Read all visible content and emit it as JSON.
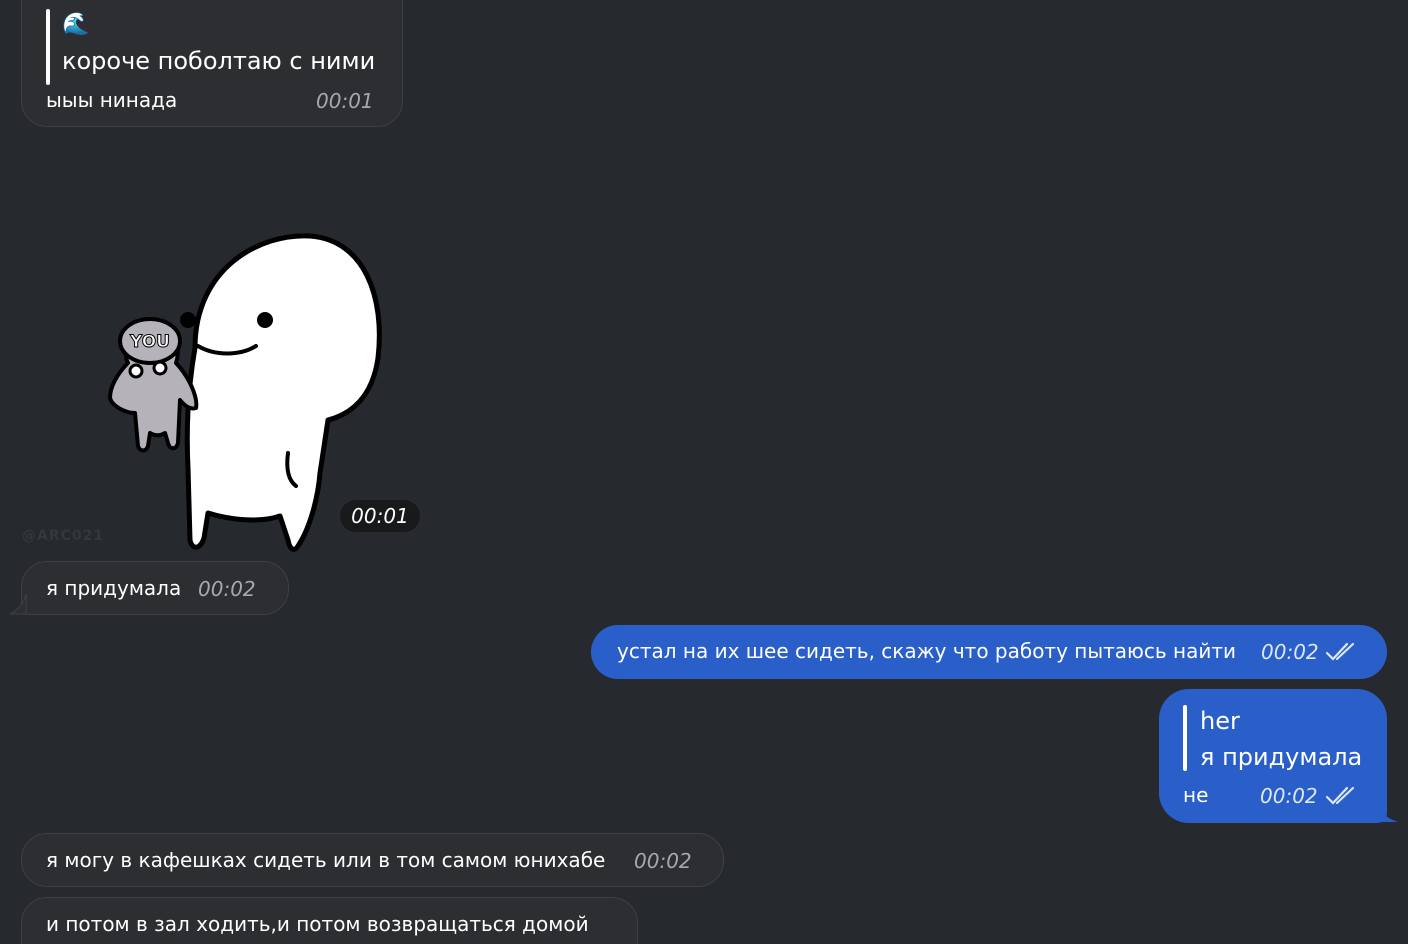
{
  "messages": {
    "m1": {
      "reply_emoji": "🌊",
      "reply_text": "короче поболтаю с ними",
      "text": "ыыы нинада",
      "time": "00:01"
    },
    "sticker": {
      "badge_text": "YOU",
      "time": "00:01",
      "watermark": "@ARC021"
    },
    "m2": {
      "text": "я придумала",
      "time": "00:02"
    },
    "m3": {
      "text": "устал на их шее сидеть, скажу что работу пытаюсь найти",
      "time": "00:02"
    },
    "m4": {
      "reply_name": "her",
      "reply_text": "я придумала",
      "text": "не",
      "time": "00:02"
    },
    "m5": {
      "text": "я могу в кафешках сидеть или в том самом юнихабе",
      "time": "00:02"
    },
    "m6": {
      "text": "и потом в зал ходить,и потом возвращаться домой"
    }
  },
  "colors": {
    "background": "#26292d",
    "incoming_bubble": "#2c2e31",
    "outgoing_bubble": "#2a5fc9",
    "time_incoming": "#a6a8ad"
  },
  "icons": {
    "read_status": "double-check-icon",
    "reply_bar": "reply-quote-bar"
  }
}
